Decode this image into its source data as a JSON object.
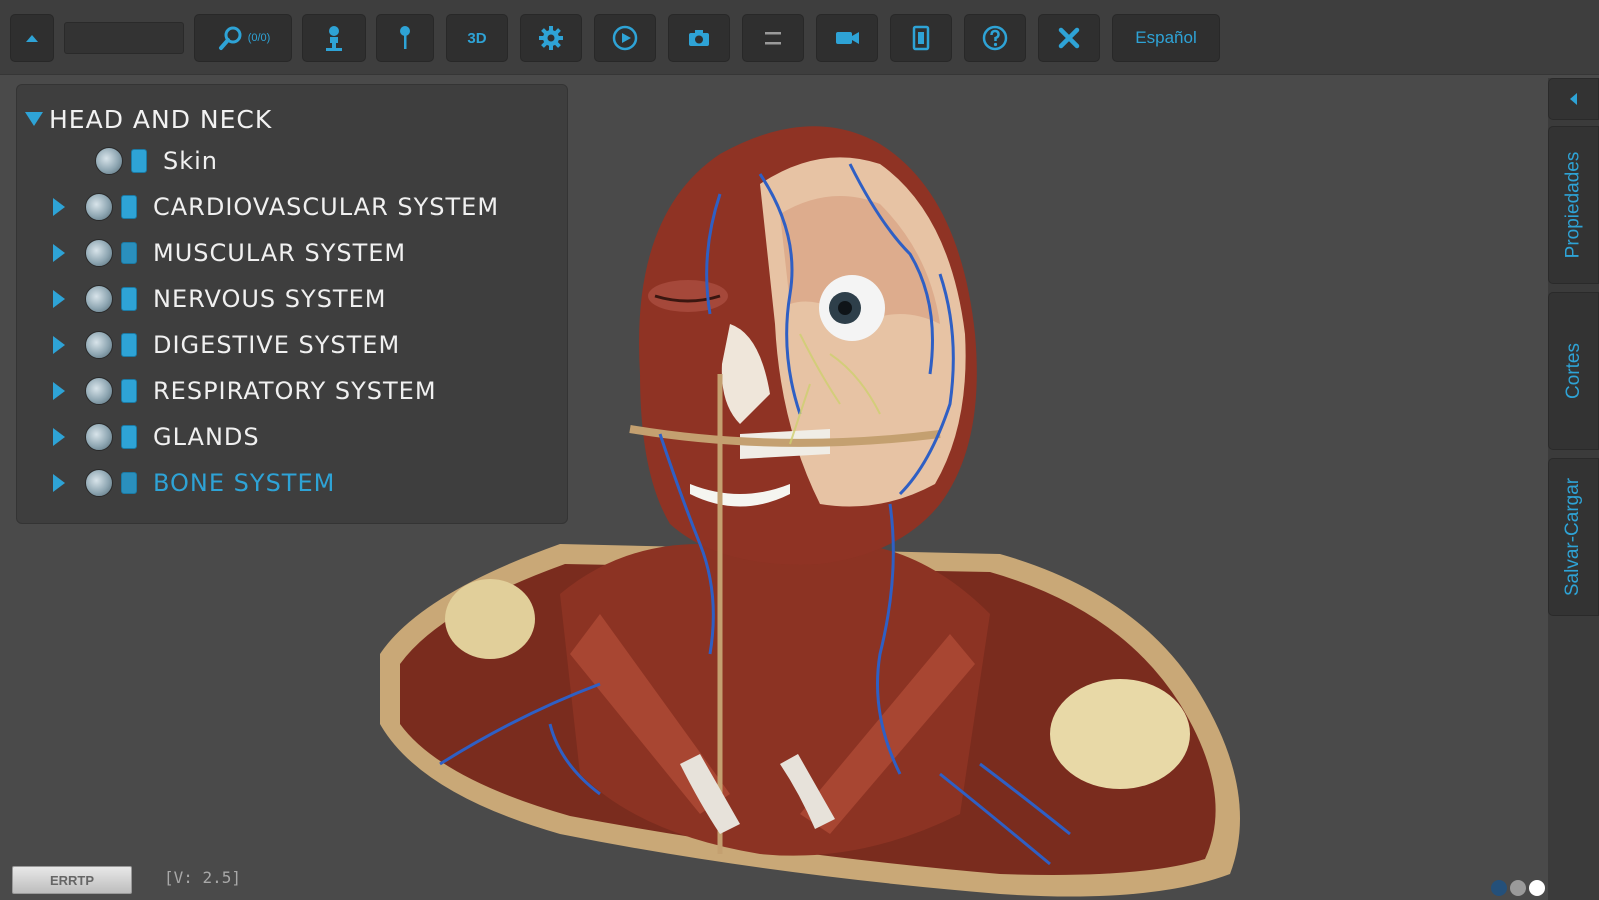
{
  "toolbar": {
    "search_count": "(0/0)",
    "btn_3d": "3D",
    "language": "Español",
    "icons": [
      "collapse-up-icon",
      "search-icon",
      "person-icon",
      "pin-icon",
      "3d-icon",
      "gear-icon",
      "play-icon",
      "camera-icon",
      "menu-lines-icon",
      "video-icon",
      "film-icon",
      "help-icon",
      "close-icon"
    ]
  },
  "tree": {
    "root": "HEAD AND NECK",
    "items": [
      {
        "label": "Skin",
        "expandable": false,
        "locked": true
      },
      {
        "label": "CARDIOVASCULAR SYSTEM",
        "expandable": true,
        "locked": true
      },
      {
        "label": "MUSCULAR SYSTEM",
        "expandable": true,
        "locked": false
      },
      {
        "label": "NERVOUS SYSTEM",
        "expandable": true,
        "locked": true
      },
      {
        "label": "DIGESTIVE SYSTEM",
        "expandable": true,
        "locked": true
      },
      {
        "label": "RESPIRATORY SYSTEM",
        "expandable": true,
        "locked": true
      },
      {
        "label": "GLANDS",
        "expandable": true,
        "locked": true
      },
      {
        "label": "BONE SYSTEM",
        "expandable": true,
        "locked": false,
        "selected": true
      }
    ]
  },
  "side_panel": {
    "tabs": [
      "Propiedades",
      "Cortes",
      "Salvar-Cargar"
    ]
  },
  "footer": {
    "logo_text": "ERRTP",
    "version": "[V: 2.5]"
  },
  "colors": {
    "accent": "#2ea3d6",
    "background": "#4a4a4a"
  }
}
